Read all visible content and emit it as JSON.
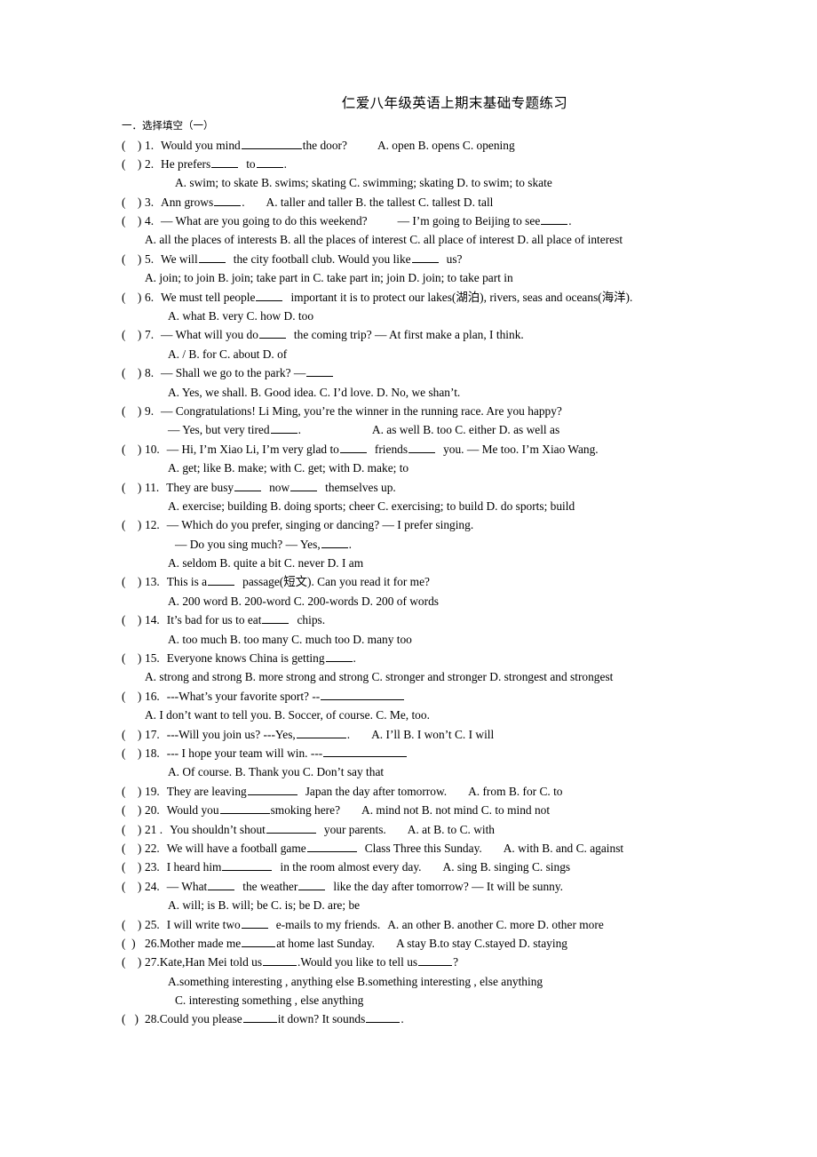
{
  "document": {
    "title": "仁爱八年级英语上期末基础专题练习",
    "section_heading": "一．选择填空（一）",
    "paren_mark": "(",
    "paren_close": ")"
  },
  "questions": [
    {
      "id": "q1",
      "number": "1.",
      "stem_pre": "Would you mind",
      "stem_post": "the door?",
      "options_inline": "A. open       B. opens    C. opening"
    },
    {
      "id": "q2",
      "number": "2.",
      "stem_pre": "He prefers",
      "stem_mid": "to",
      "stem_post": ".",
      "options_line": "A. swim; to skate         B. swims; skating          C. swimming; skating   D. to swim; to skate"
    },
    {
      "id": "q3",
      "number": "3.",
      "stem_pre": "Ann grows",
      "stem_post": ".",
      "options_inline": "A. taller and taller       B. the tallest        C. tallest       D. tall"
    },
    {
      "id": "q4",
      "number": "4.",
      "stem_pre": "— What are you going to do this weekend?",
      "stem_mid": "— I’m going to Beijing to see",
      "stem_post": ".",
      "options_line": "A. all the places of interests    B. all the places of interest    C. all place of interest   D. all place of interest"
    },
    {
      "id": "q5",
      "number": "5.",
      "stem_pre": "We will",
      "stem_mid": "the city football club. Would you like",
      "stem_post": "us?",
      "options_line": "A. join; to join      B. join; take part in     C. take part in; join              D. join; to take part in"
    },
    {
      "id": "q6",
      "number": "6.",
      "stem_pre": "We must tell people",
      "stem_post": "important it is to protect our lakes(湖泊), rivers, seas and oceans(海洋).",
      "options_line": "A. what         B. very                  C. how                  D. too"
    },
    {
      "id": "q7",
      "number": "7.",
      "stem_pre": "— What will you do",
      "stem_post": "the coming trip?      — At first make a plan, I think.",
      "options_line": "A. /             B. for        C. about           D. of"
    },
    {
      "id": "q8",
      "number": "8.",
      "stem_pre": "— Shall we go to the park?    —",
      "options_line": "A. Yes, we shall.     B. Good idea.     C. I’d love.       D. No, we shan’t."
    },
    {
      "id": "q9",
      "number": "9.",
      "stem_pre": "— Congratulations! Li Ming, you’re the winner in the running race. Are you happy?",
      "cont_pre": "— Yes, but very tired",
      "cont_post": ".",
      "options_inline": "A. as well    B. too       C. either    D. as well as"
    },
    {
      "id": "q10",
      "number": "10.",
      "stem_pre": "— Hi, I’m Xiao Li, I’m very glad to",
      "stem_mid": "friends",
      "stem_post": "you.       — Me too. I’m Xiao Wang.",
      "options_line": "A. get; like    B. make; with     C. get; with        D. make; to"
    },
    {
      "id": "q11",
      "number": "11.",
      "stem_pre": "They are busy",
      "stem_mid": "now",
      "stem_post": "themselves up.",
      "options_line": "A. exercise; building       B. doing sports; cheer    C. exercising; to build        D. do sports; build"
    },
    {
      "id": "q12",
      "number": "12.",
      "stem_pre": "— Which do you prefer, singing or dancing?    — I prefer singing.",
      "cont_pre": "— Do you sing much?        — Yes,",
      "cont_post": ".",
      "options_line": "A. seldom     B. quite a bit     C. never           D. I am"
    },
    {
      "id": "q13",
      "number": "13.",
      "stem_pre": "This is a",
      "stem_post": "passage(短文). Can you read it for me?",
      "options_line": "A. 200 word                  B. 200-word             C. 200-words           D. 200 of words"
    },
    {
      "id": "q14",
      "number": "14.",
      "stem_pre": "It’s bad for us to eat",
      "stem_post": "chips.",
      "options_line": "A. too much                  B. too many             C. much too             D. many too"
    },
    {
      "id": "q15",
      "number": "15.",
      "stem_pre": "Everyone knows China is getting",
      "stem_post": ".",
      "options_line": "A. strong and strong     B. more strong and strong   C. stronger and stronger      D. strongest and strongest"
    },
    {
      "id": "q16",
      "number": "16.",
      "stem_pre": "---What’s your favorite sport?          --",
      "options_line": "A. I don’t want to tell you.     B. Soccer, of course.     C. Me, too."
    },
    {
      "id": "q17",
      "number": "17.",
      "stem_pre": "---Will you join us?        ---Yes,",
      "stem_post": ".",
      "options_inline": "A. I’ll          B. I won’t       C. I will"
    },
    {
      "id": "q18",
      "number": "18.",
      "stem_pre": "--- I hope your team will win.        ---",
      "options_line": "A. Of course.                 B. Thank you            C. Don’t say that"
    },
    {
      "id": "q19",
      "number": "19.",
      "stem_pre": "They are leaving",
      "stem_post": "Japan the day after tomorrow.",
      "options_inline": "A. from         B. for           C. to"
    },
    {
      "id": "q20",
      "number": "20.",
      "stem_pre": "Would you",
      "stem_post": "smoking here?",
      "options_inline": "A. mind not         B. not mind          C. to mind not"
    },
    {
      "id": "q21",
      "number": "21 .",
      "stem_pre": "You shouldn’t shout",
      "stem_post": "your parents.",
      "options_inline": "A. at            B. to       C. with"
    },
    {
      "id": "q22",
      "number": "22.",
      "stem_pre": "We will have a football game",
      "stem_post": "Class Three this Sunday.",
      "options_inline": "A. with      B. and      C. against"
    },
    {
      "id": "q23",
      "number": "23.",
      "stem_pre": "I heard him",
      "stem_post": "in the room almost every day.",
      "options_inline": "A. sing       B. singing      C. sings"
    },
    {
      "id": "q24",
      "number": "24.",
      "stem_pre": "— What",
      "stem_mid": "the weather",
      "stem_post": "like the day after tomorrow?      — It will be sunny.",
      "options_line": "A. will; is                       B. will; be         C. is; be                  D. are; be"
    },
    {
      "id": "q25",
      "number": "25.",
      "stem_pre": "I will write two",
      "stem_post": "e-mails to my friends.",
      "options_inline": "A. an other   B. another    C. more     D. other more"
    },
    {
      "id": "q26",
      "number": "26.",
      "stem_pre": "Mother made me",
      "stem_post": "at home last Sunday.",
      "options_inline": "A stay      B.to stay      C.stayed      D. staying"
    },
    {
      "id": "q27",
      "number": "27.",
      "stem_pre": "Kate,Han Mei told us",
      "stem_mid": ".Would you like to tell us",
      "stem_post": "?",
      "options_line": "A.something interesting , anything else        B.something interesting , else anything",
      "options_line2": "C. interesting something , else anything"
    },
    {
      "id": "q28",
      "number": "28.",
      "stem_pre": "Could you please",
      "stem_mid": "it down? It sounds",
      "stem_post": "."
    }
  ]
}
